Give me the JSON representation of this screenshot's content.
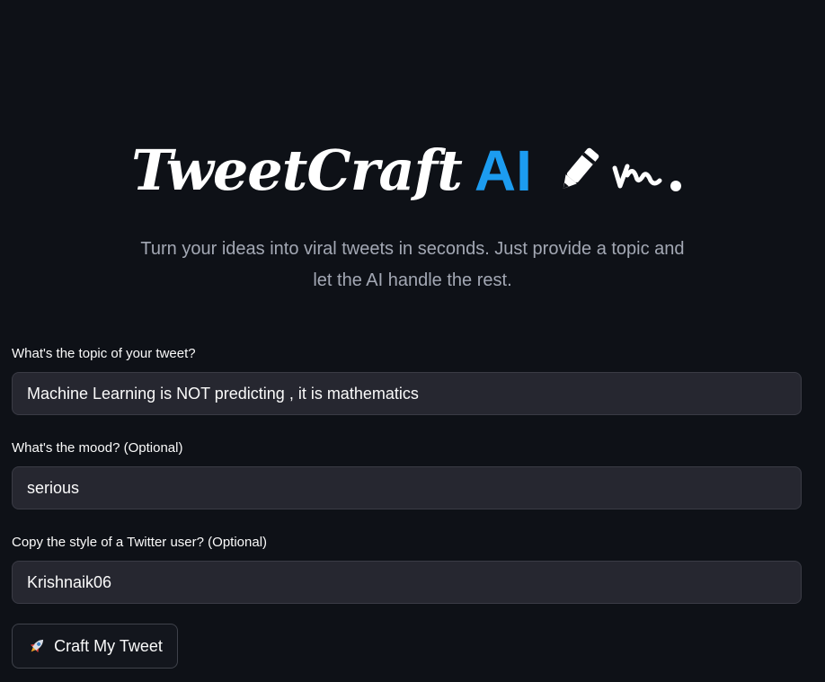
{
  "header": {
    "brand_script": "TweetCraft",
    "brand_ai": "AI",
    "subtitle_line1": "Turn your ideas into viral tweets in seconds. Just provide a topic and",
    "subtitle_line2": "let the AI handle the rest.",
    "icon": "pencil-writing-icon"
  },
  "form": {
    "topic": {
      "label": "What's the topic of your tweet?",
      "value": "Machine Learning is NOT predicting , it is mathematics"
    },
    "mood": {
      "label": "What's the mood? (Optional)",
      "value": "serious"
    },
    "style": {
      "label": "Copy the style of a Twitter user? (Optional)",
      "value": "Krishnaik06"
    },
    "submit": {
      "icon": "rocket-icon",
      "label": "Craft My Tweet"
    }
  },
  "colors": {
    "background": "#0e1117",
    "accent": "#1c9cf0",
    "input_bg": "#262730",
    "text": "#fafafa",
    "muted": "#a3a8b4"
  }
}
